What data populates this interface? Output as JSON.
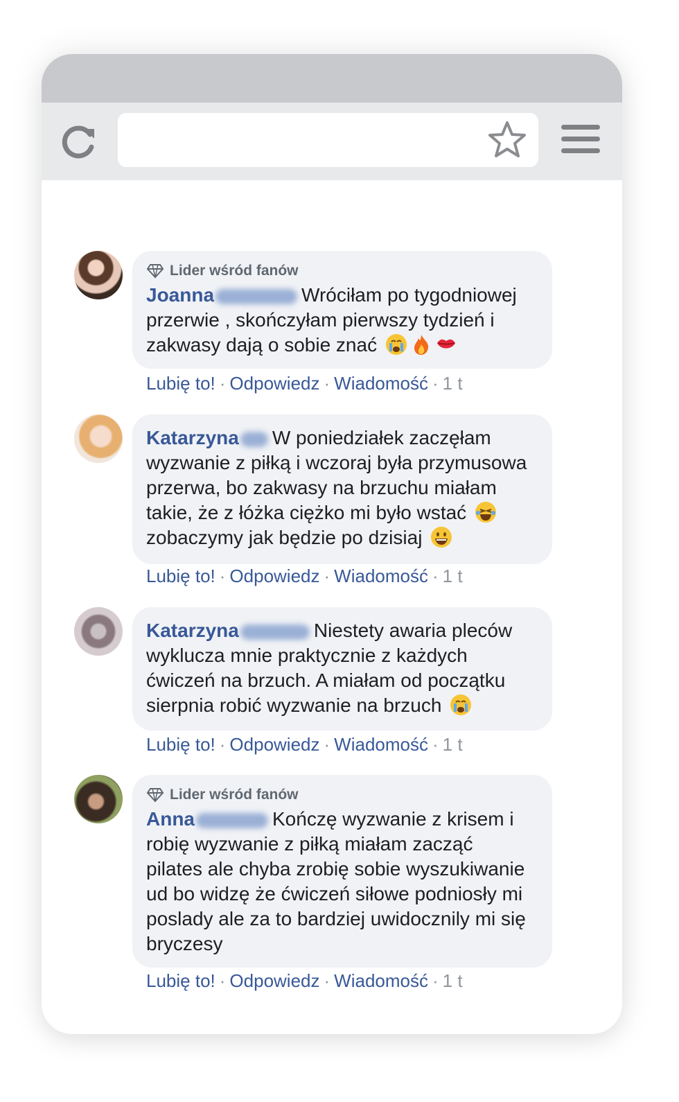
{
  "browser": {
    "reload_icon": "reload-icon",
    "bookmark_icon": "star-icon",
    "menu_icon": "hamburger-menu-icon",
    "url": ""
  },
  "actions": {
    "like": "Lubię to!",
    "reply": "Odpowiedz",
    "message": "Wiadomość",
    "separator": "·",
    "time": "1 t"
  },
  "comments": [
    {
      "badge": "Lider wśród fanów",
      "first_name": "Joanna",
      "lines": [
        "Wróciłam po tygodniowej",
        "przerwie , skończyłam pierwszy tydzień i",
        "zakwasy dają o sobie znać"
      ],
      "emojis": [
        "crying-face",
        "fire",
        "kiss-lips"
      ]
    },
    {
      "badge": "",
      "first_name": "Katarzyna",
      "lines": [
        "W poniedziałek zaczęłam",
        "wyzwanie z piłką i wczoraj była przymusowa",
        "przerwa, bo zakwasy na brzuchu miałam",
        "takie, że z łóżka ciężko mi było wstać",
        "zobaczymy jak będzie po dzisiaj"
      ],
      "emojis": [
        "laughing-tears-face",
        "grinning-face"
      ]
    },
    {
      "badge": "",
      "first_name": "Katarzyna",
      "lines": [
        "Niestety awaria pleców",
        "wyklucza mnie praktycznie z każdych",
        "ćwiczeń na brzuch. A miałam od początku",
        "sierpnia robić wyzwanie na brzuch"
      ],
      "emojis": [
        "crying-face"
      ]
    },
    {
      "badge": "Lider wśród fanów",
      "first_name": "Anna",
      "lines": [
        "Kończę wyzwanie z krisem i",
        "robię wyzwanie z piłką miałam zacząć",
        "pilates ale chyba zrobię sobie wyszukiwanie",
        "ud bo widzę że ćwiczeń siłowe podniosły mi",
        "poslady ale za to bardziej uwidocznily mi się",
        "bryczesy"
      ],
      "emojis": []
    }
  ]
}
